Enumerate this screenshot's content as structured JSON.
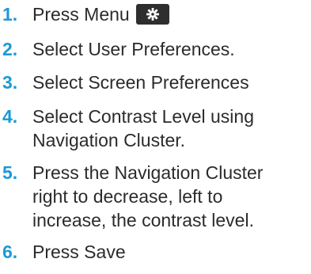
{
  "steps": [
    {
      "number": "1.",
      "lines": [
        "Press Menu"
      ],
      "icon": "gear-icon"
    },
    {
      "number": "2.",
      "lines": [
        "Select User Preferences."
      ]
    },
    {
      "number": "3.",
      "lines": [
        "Select Screen Preferences"
      ]
    },
    {
      "number": "4.",
      "lines": [
        "Select Contrast Level using",
        "Navigation Cluster."
      ]
    },
    {
      "number": "5.",
      "lines": [
        "Press the Navigation Cluster",
        "right to decrease, left to",
        "increase, the contrast level."
      ]
    },
    {
      "number": "6.",
      "lines": [
        "Press Save"
      ]
    }
  ],
  "colors": {
    "number": "#1c9ad6",
    "text": "#2b2b2b",
    "key_background": "#2e2e2e",
    "key_icon": "#ffffff"
  }
}
